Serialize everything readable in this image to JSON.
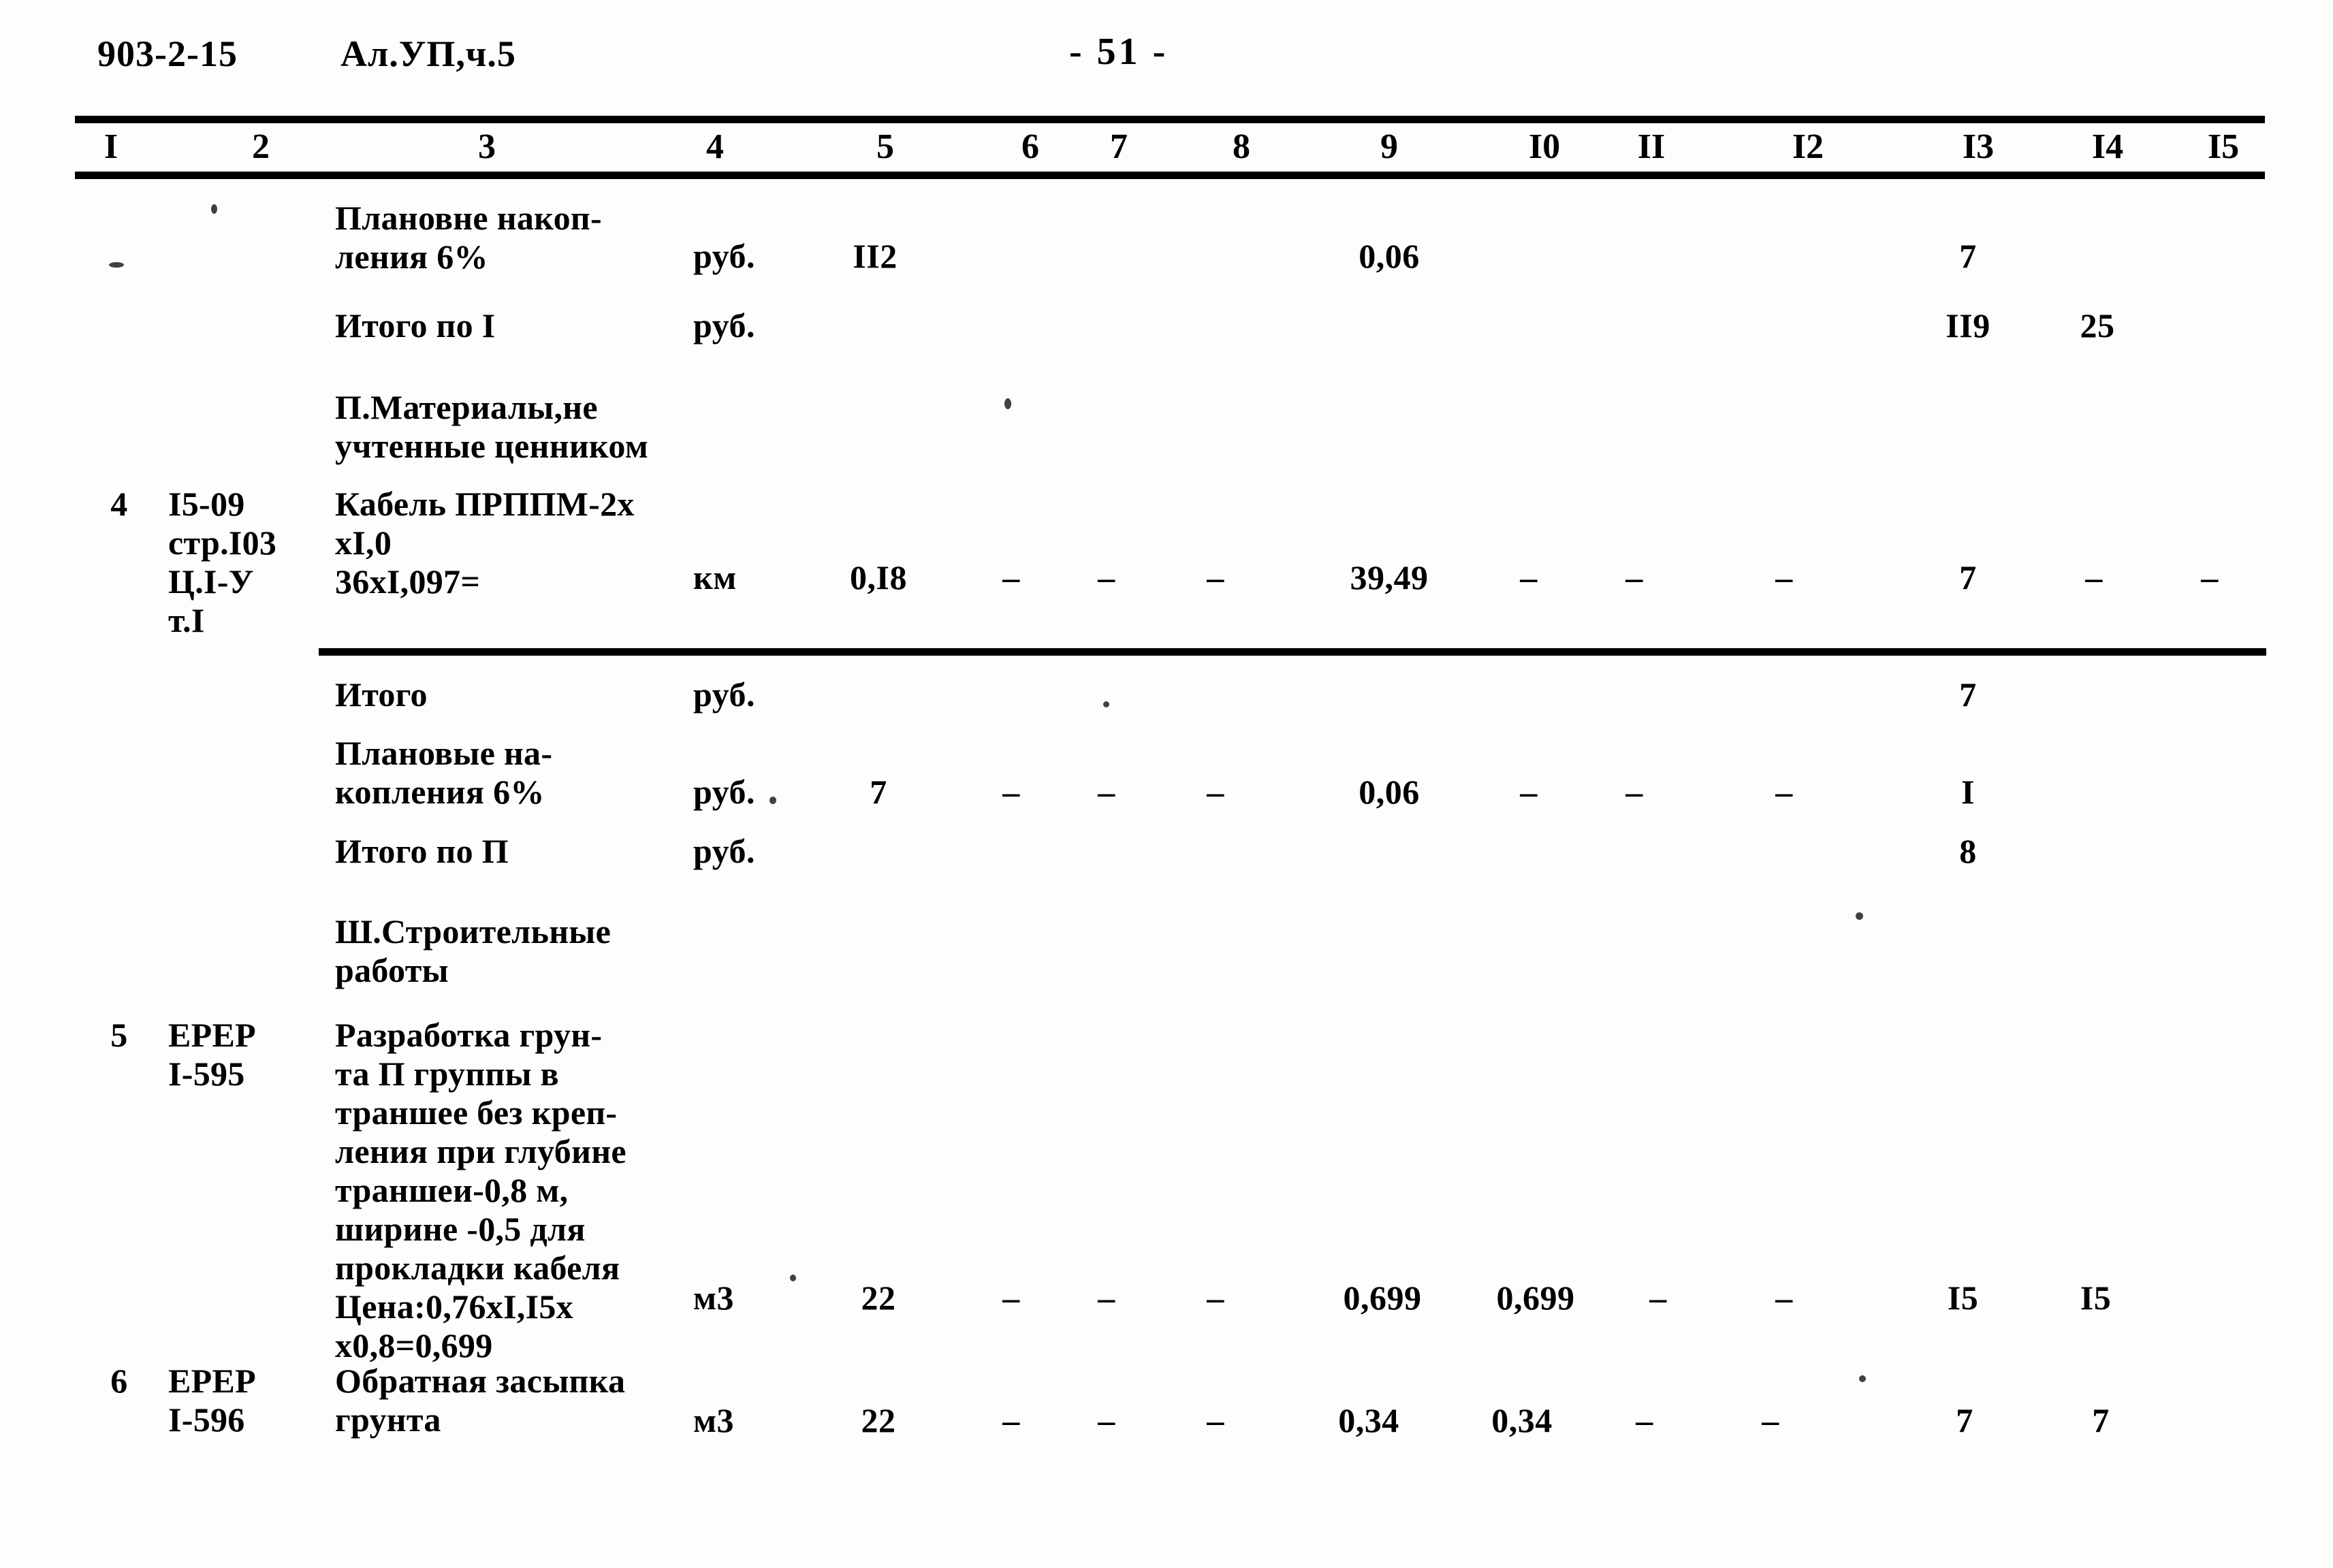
{
  "header": {
    "doc_code": "903-2-15",
    "album": "Ал.УП,ч.5",
    "page_number": "- 51 -"
  },
  "table": {
    "column_headers": [
      "I",
      "2",
      "3",
      "4",
      "5",
      "6",
      "7",
      "8",
      "9",
      "I0",
      "II",
      "I2",
      "I3",
      "I4",
      "I5"
    ],
    "rows": [
      {
        "id": "row-planovye-nakopleniya-1",
        "col1": "",
        "col2": "",
        "col3": "Плановне накоп-\nления 6%",
        "col4": "руб.",
        "col5": "II2",
        "col6": "",
        "col7": "",
        "col8": "",
        "col9": "0,06",
        "col10": "",
        "col11": "",
        "col12": "",
        "col13": "7",
        "col14": "",
        "col15": ""
      },
      {
        "id": "row-itogo-po-1",
        "col1": "",
        "col2": "",
        "col3": "Итого по I",
        "col4": "руб.",
        "col5": "",
        "col6": "",
        "col7": "",
        "col8": "",
        "col9": "",
        "col10": "",
        "col11": "",
        "col12": "",
        "col13": "II9",
        "col14": "25",
        "col15": ""
      },
      {
        "id": "row-section-2-heading",
        "col1": "",
        "col2": "",
        "col3": "П.Материалы,не\nучтенные ценником",
        "col4": "",
        "col5": "",
        "col6": "",
        "col7": "",
        "col8": "",
        "col9": "",
        "col10": "",
        "col11": "",
        "col12": "",
        "col13": "",
        "col14": "",
        "col15": ""
      },
      {
        "id": "row-4-kabel",
        "col1": "4",
        "col2": "I5-09\nстр.I03\nЦ.I-У\nт.I",
        "col3": "Кабель ПРППМ-2х\nхI,0\n36хI,097=",
        "col4": "км",
        "col5": "0,I8",
        "col6": "–",
        "col7": "–",
        "col8": "–",
        "col9": "39,49",
        "col10": "–",
        "col11": "–",
        "col12": "–",
        "col13": "7",
        "col14": "–",
        "col15": "–"
      },
      {
        "id": "row-itogo",
        "col1": "",
        "col2": "",
        "col3": "Итого",
        "col4": "руб.",
        "col5": "",
        "col6": "",
        "col7": "",
        "col8": "",
        "col9": "",
        "col10": "",
        "col11": "",
        "col12": "",
        "col13": "7",
        "col14": "",
        "col15": ""
      },
      {
        "id": "row-planovye-nakopleniya-2",
        "col1": "",
        "col2": "",
        "col3": "Плановые на-\nкопления 6%",
        "col4": "руб.",
        "col5": "7",
        "col6": "–",
        "col7": "–",
        "col8": "–",
        "col9": "0,06",
        "col10": "–",
        "col11": "–",
        "col12": "–",
        "col13": "I",
        "col14": "",
        "col15": ""
      },
      {
        "id": "row-itogo-po-2",
        "col1": "",
        "col2": "",
        "col3": "Итого по П",
        "col4": "руб.",
        "col5": "",
        "col6": "",
        "col7": "",
        "col8": "",
        "col9": "",
        "col10": "",
        "col11": "",
        "col12": "",
        "col13": "8",
        "col14": "",
        "col15": ""
      },
      {
        "id": "row-section-3-heading",
        "col1": "",
        "col2": "",
        "col3": "Ш.Строительные\n  работы",
        "col4": "",
        "col5": "",
        "col6": "",
        "col7": "",
        "col8": "",
        "col9": "",
        "col10": "",
        "col11": "",
        "col12": "",
        "col13": "",
        "col14": "",
        "col15": ""
      },
      {
        "id": "row-5-razrabotka",
        "col1": "5",
        "col2": "ЕРЕР\nI-595",
        "col3": "Разработка грун-\nта П группы в\nтраншее без креп-\nления при глубине\nтраншеи-0,8 м,\nширине -0,5  для\nпрокладки кабеля\nЦена:0,76хI,I5х\nх0,8=0,699",
        "col4": "м3",
        "col5": "22",
        "col6": "–",
        "col7": "–",
        "col8": "–",
        "col9": "0,699",
        "col10": "0,699",
        "col11": "–",
        "col12": "–",
        "col13": "I5",
        "col14": "I5",
        "col15": ""
      },
      {
        "id": "row-6-obratnaya",
        "col1": "6",
        "col2": "ЕРЕР\nI-596",
        "col3": "Обратная засыпка\nгрунта",
        "col4": "м3",
        "col5": "22",
        "col6": "–",
        "col7": "–",
        "col8": "–",
        "col9": "0,34",
        "col10": "0,34",
        "col11": "–",
        "col12": "–",
        "col13": "7",
        "col14": "7",
        "col15": ""
      }
    ]
  }
}
